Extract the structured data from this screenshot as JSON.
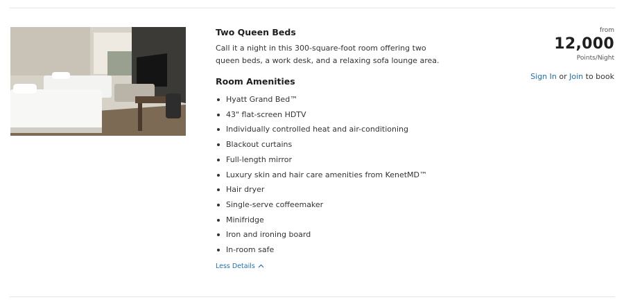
{
  "room": {
    "title": "Two Queen Beds",
    "description": "Call it a night in this 300-square-foot room offering two queen beds, a work desk, and a relaxing sofa lounge area.",
    "amenities_title": "Room Amenities",
    "amenities": [
      "Hyatt Grand Bed™",
      "43\" flat-screen HDTV",
      "Individually controlled heat and air-conditioning",
      "Blackout curtains",
      "Full-length mirror",
      "Luxury skin and hair care amenities from KenetMD™",
      "Hair dryer",
      "Single-serve coffeemaker",
      "Minifridge",
      "Iron and ironing board",
      "In-room safe"
    ],
    "less_details_label": "Less Details",
    "toggle_icon": "chevron-up-icon"
  },
  "price": {
    "from_label": "from",
    "points": "12,000",
    "unit": "Points/Night",
    "sign_in_label": "Sign In",
    "or_label": "or",
    "join_label": "Join",
    "to_book_label": "to book"
  },
  "colors": {
    "link": "#1c6fb0",
    "text": "#333333",
    "divider": "#e4e4e4"
  }
}
